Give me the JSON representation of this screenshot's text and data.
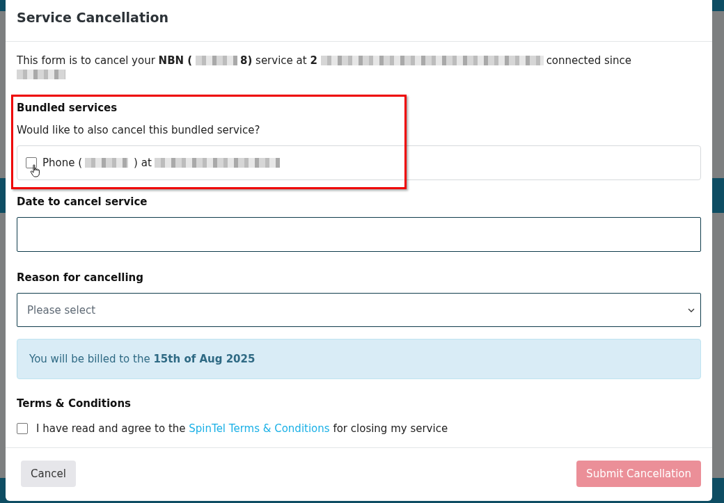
{
  "dialog": {
    "title": "Service Cancellation"
  },
  "intro": [
    {
      "kind": "text",
      "text": "This form is to cancel your **NBN (**"
    },
    {
      "kind": "redacted"
    },
    {
      "kind": "text",
      "text": "**8)** service at **2**"
    },
    {
      "kind": "redacted"
    },
    {
      "kind": "text",
      "text": "connected since"
    },
    {
      "kind": "redacted"
    }
  ],
  "bundled": {
    "heading": "Bundled services",
    "question": "Would like to also cancel this bundled service?",
    "highlighted": true,
    "items": [
      {
        "checked": false,
        "hovered": true,
        "parts": [
          {
            "kind": "text",
            "text": "Phone ("
          },
          {
            "kind": "redacted"
          },
          {
            "kind": "text",
            "text": ") at"
          },
          {
            "kind": "redacted"
          }
        ]
      }
    ]
  },
  "date_field": {
    "label": "Date to cancel service"
  },
  "reason_field": {
    "label": "Reason for cancelling",
    "placeholder": "Please select"
  },
  "notice": {
    "text": "You will be billed to the **15th of Aug 2025**"
  },
  "terms": {
    "heading": "Terms & Conditions",
    "checked": false,
    "before": "I have read and agree to the",
    "link": "SpinTel Terms & Conditions",
    "after": "for closing my service"
  },
  "buttons": [
    {
      "label": "Cancel",
      "kind": "secondary",
      "disabled": false
    },
    {
      "label": "Submit Cancellation",
      "kind": "primary",
      "disabled": true
    }
  ]
}
